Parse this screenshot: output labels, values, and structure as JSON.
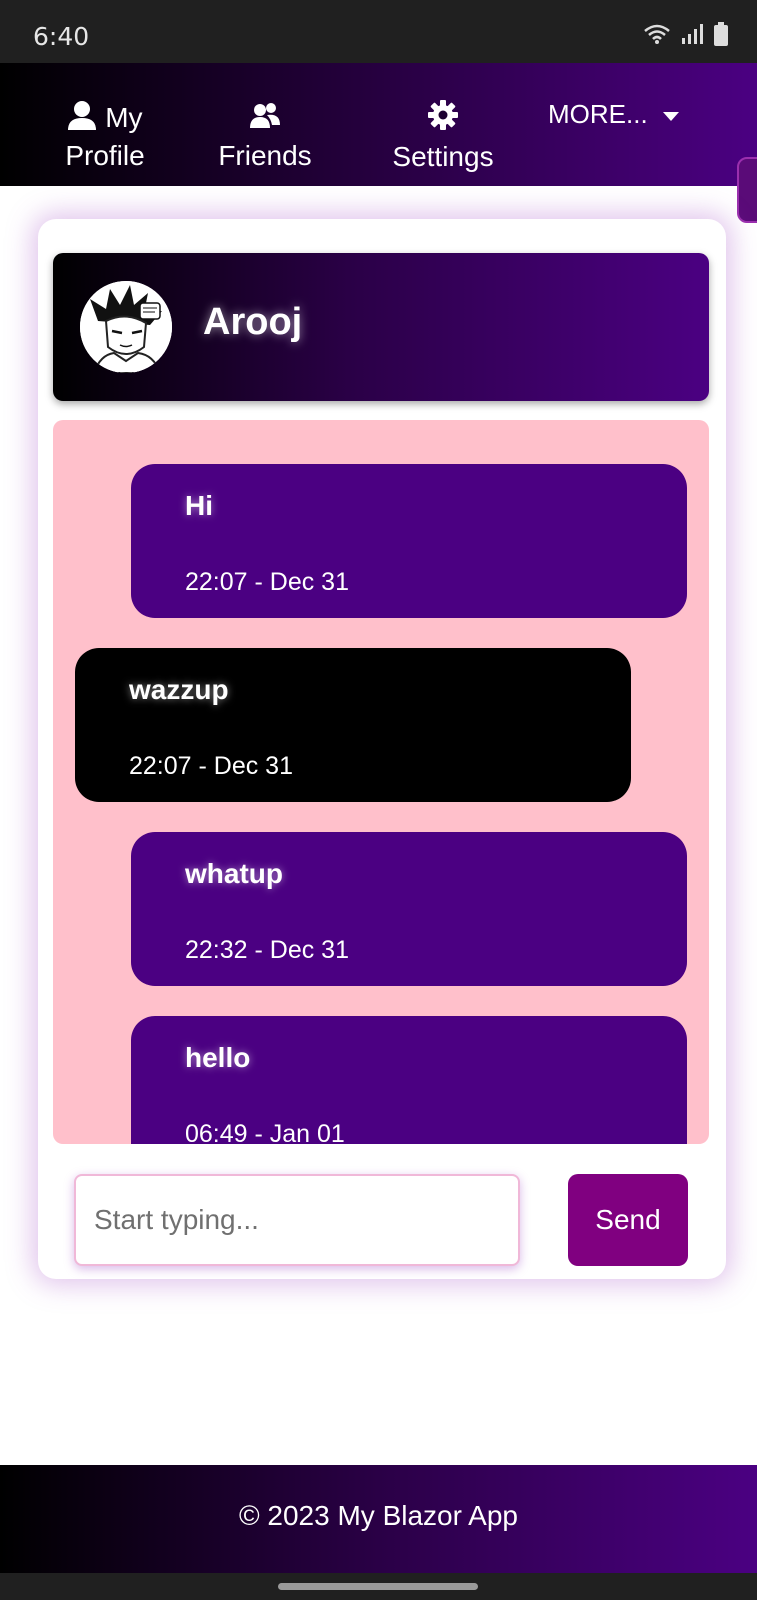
{
  "status_bar": {
    "time": "6:40",
    "icons": [
      "wifi-icon",
      "signal-icon",
      "battery-icon"
    ]
  },
  "nav": {
    "profile_label_line1": "My",
    "profile_label_line2": "Profile",
    "friends_label": "Friends",
    "settings_label": "Settings",
    "more_label": "MORE..."
  },
  "chat": {
    "contact_name": "Arooj",
    "messages": [
      {
        "text": "Hi",
        "time": "22:07 - Dec 31",
        "side": "sent"
      },
      {
        "text": "wazzup",
        "time": "22:07 - Dec 31",
        "side": "received"
      },
      {
        "text": "whatup",
        "time": "22:32 - Dec 31",
        "side": "sent"
      },
      {
        "text": "hello",
        "time": "06:49 - Jan 01",
        "side": "sent"
      }
    ],
    "input_placeholder": "Start typing...",
    "send_label": "Send"
  },
  "footer": {
    "text": "© 2023 My Blazor App"
  },
  "colors": {
    "accent_purple": "#4b0082",
    "messages_bg": "#ffc0cb",
    "send_button": "#800080"
  }
}
